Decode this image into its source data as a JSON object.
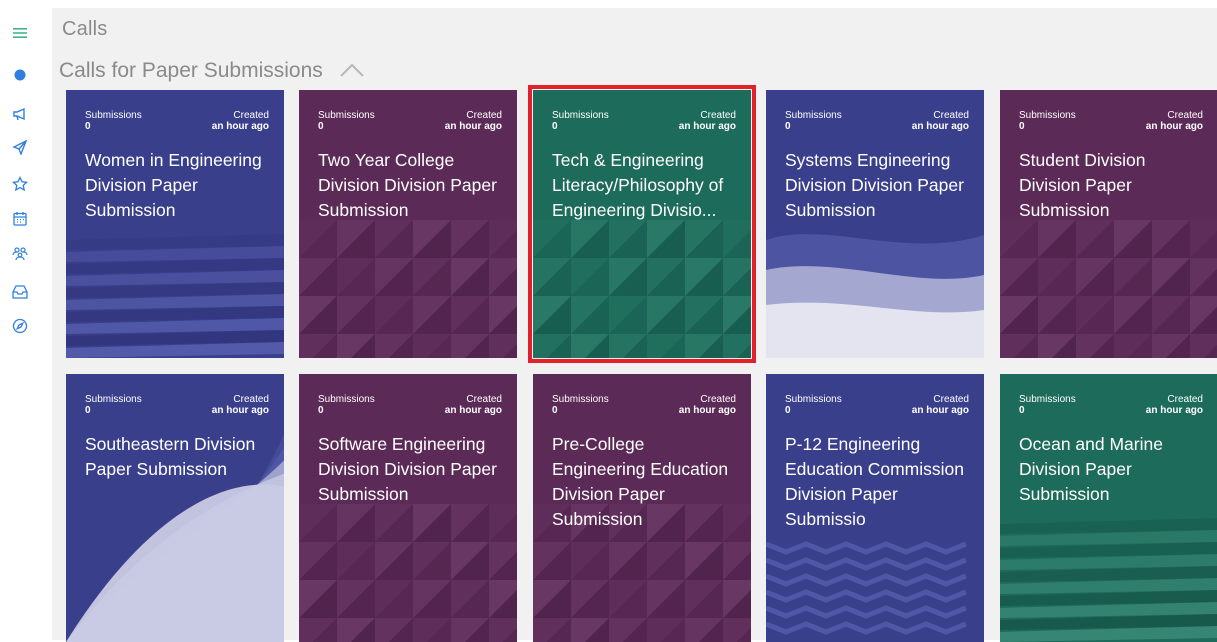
{
  "breadcrumb": "Calls",
  "section": {
    "title": "Calls for Paper Submissions"
  },
  "sidebar": {
    "icons": [
      "menu-icon",
      "status-dot-icon",
      "megaphone-icon",
      "send-icon",
      "star-icon",
      "calendar-icon",
      "people-icon",
      "inbox-icon",
      "compass-icon"
    ]
  },
  "colors": {
    "blue": "#3a3f8c",
    "purple": "#5c2a57",
    "green": "#1d6b5a",
    "sidebar_accent": "#2f7fe0",
    "selection": "#e0202a"
  },
  "cards": [
    {
      "submissions_label": "Submissions",
      "submissions": "0",
      "created_label": "Created",
      "created": "an hour ago",
      "title": "Women in Engineering Division Paper Submission",
      "theme": "blue",
      "pattern": "stripes"
    },
    {
      "submissions_label": "Submissions",
      "submissions": "0",
      "created_label": "Created",
      "created": "an hour ago",
      "title": "Two Year College Division Division Paper Submission",
      "theme": "purple",
      "pattern": "triangles"
    },
    {
      "submissions_label": "Submissions",
      "submissions": "0",
      "created_label": "Created",
      "created": "an hour ago",
      "title": "Tech & Engineering Literacy/Philosophy of Engineering Divisio...",
      "theme": "green",
      "pattern": "triangles",
      "selected": true
    },
    {
      "submissions_label": "Submissions",
      "submissions": "0",
      "created_label": "Created",
      "created": "an hour ago",
      "title": "Systems Engineering Division Division Paper Submission",
      "theme": "blue",
      "pattern": "waves"
    },
    {
      "submissions_label": "Submissions",
      "submissions": "0",
      "created_label": "Created",
      "created": "an hour ago",
      "title": "Student Division Division Paper Submission",
      "theme": "purple",
      "pattern": "triangles"
    },
    {
      "submissions_label": "Submissions",
      "submissions": "0",
      "created_label": "Created",
      "created": "an hour ago",
      "title": "Southeastern Division Paper Submission",
      "theme": "blue",
      "pattern": "curves"
    },
    {
      "submissions_label": "Submissions",
      "submissions": "0",
      "created_label": "Created",
      "created": "an hour ago",
      "title": "Software Engineering Division Division Paper Submission",
      "theme": "purple",
      "pattern": "triangles"
    },
    {
      "submissions_label": "Submissions",
      "submissions": "0",
      "created_label": "Created",
      "created": "an hour ago",
      "title": "Pre-College Engineering Education Division Paper Submission",
      "theme": "purple",
      "pattern": "triangles"
    },
    {
      "submissions_label": "Submissions",
      "submissions": "0",
      "created_label": "Created",
      "created": "an hour ago",
      "title": "P-12 Engineering Education Commission Division Paper Submissio",
      "theme": "blue",
      "pattern": "zigzag"
    },
    {
      "submissions_label": "Submissions",
      "submissions": "0",
      "created_label": "Created",
      "created": "an hour ago",
      "title": "Ocean and Marine Division Paper Submission",
      "theme": "green",
      "pattern": "stripes"
    }
  ]
}
